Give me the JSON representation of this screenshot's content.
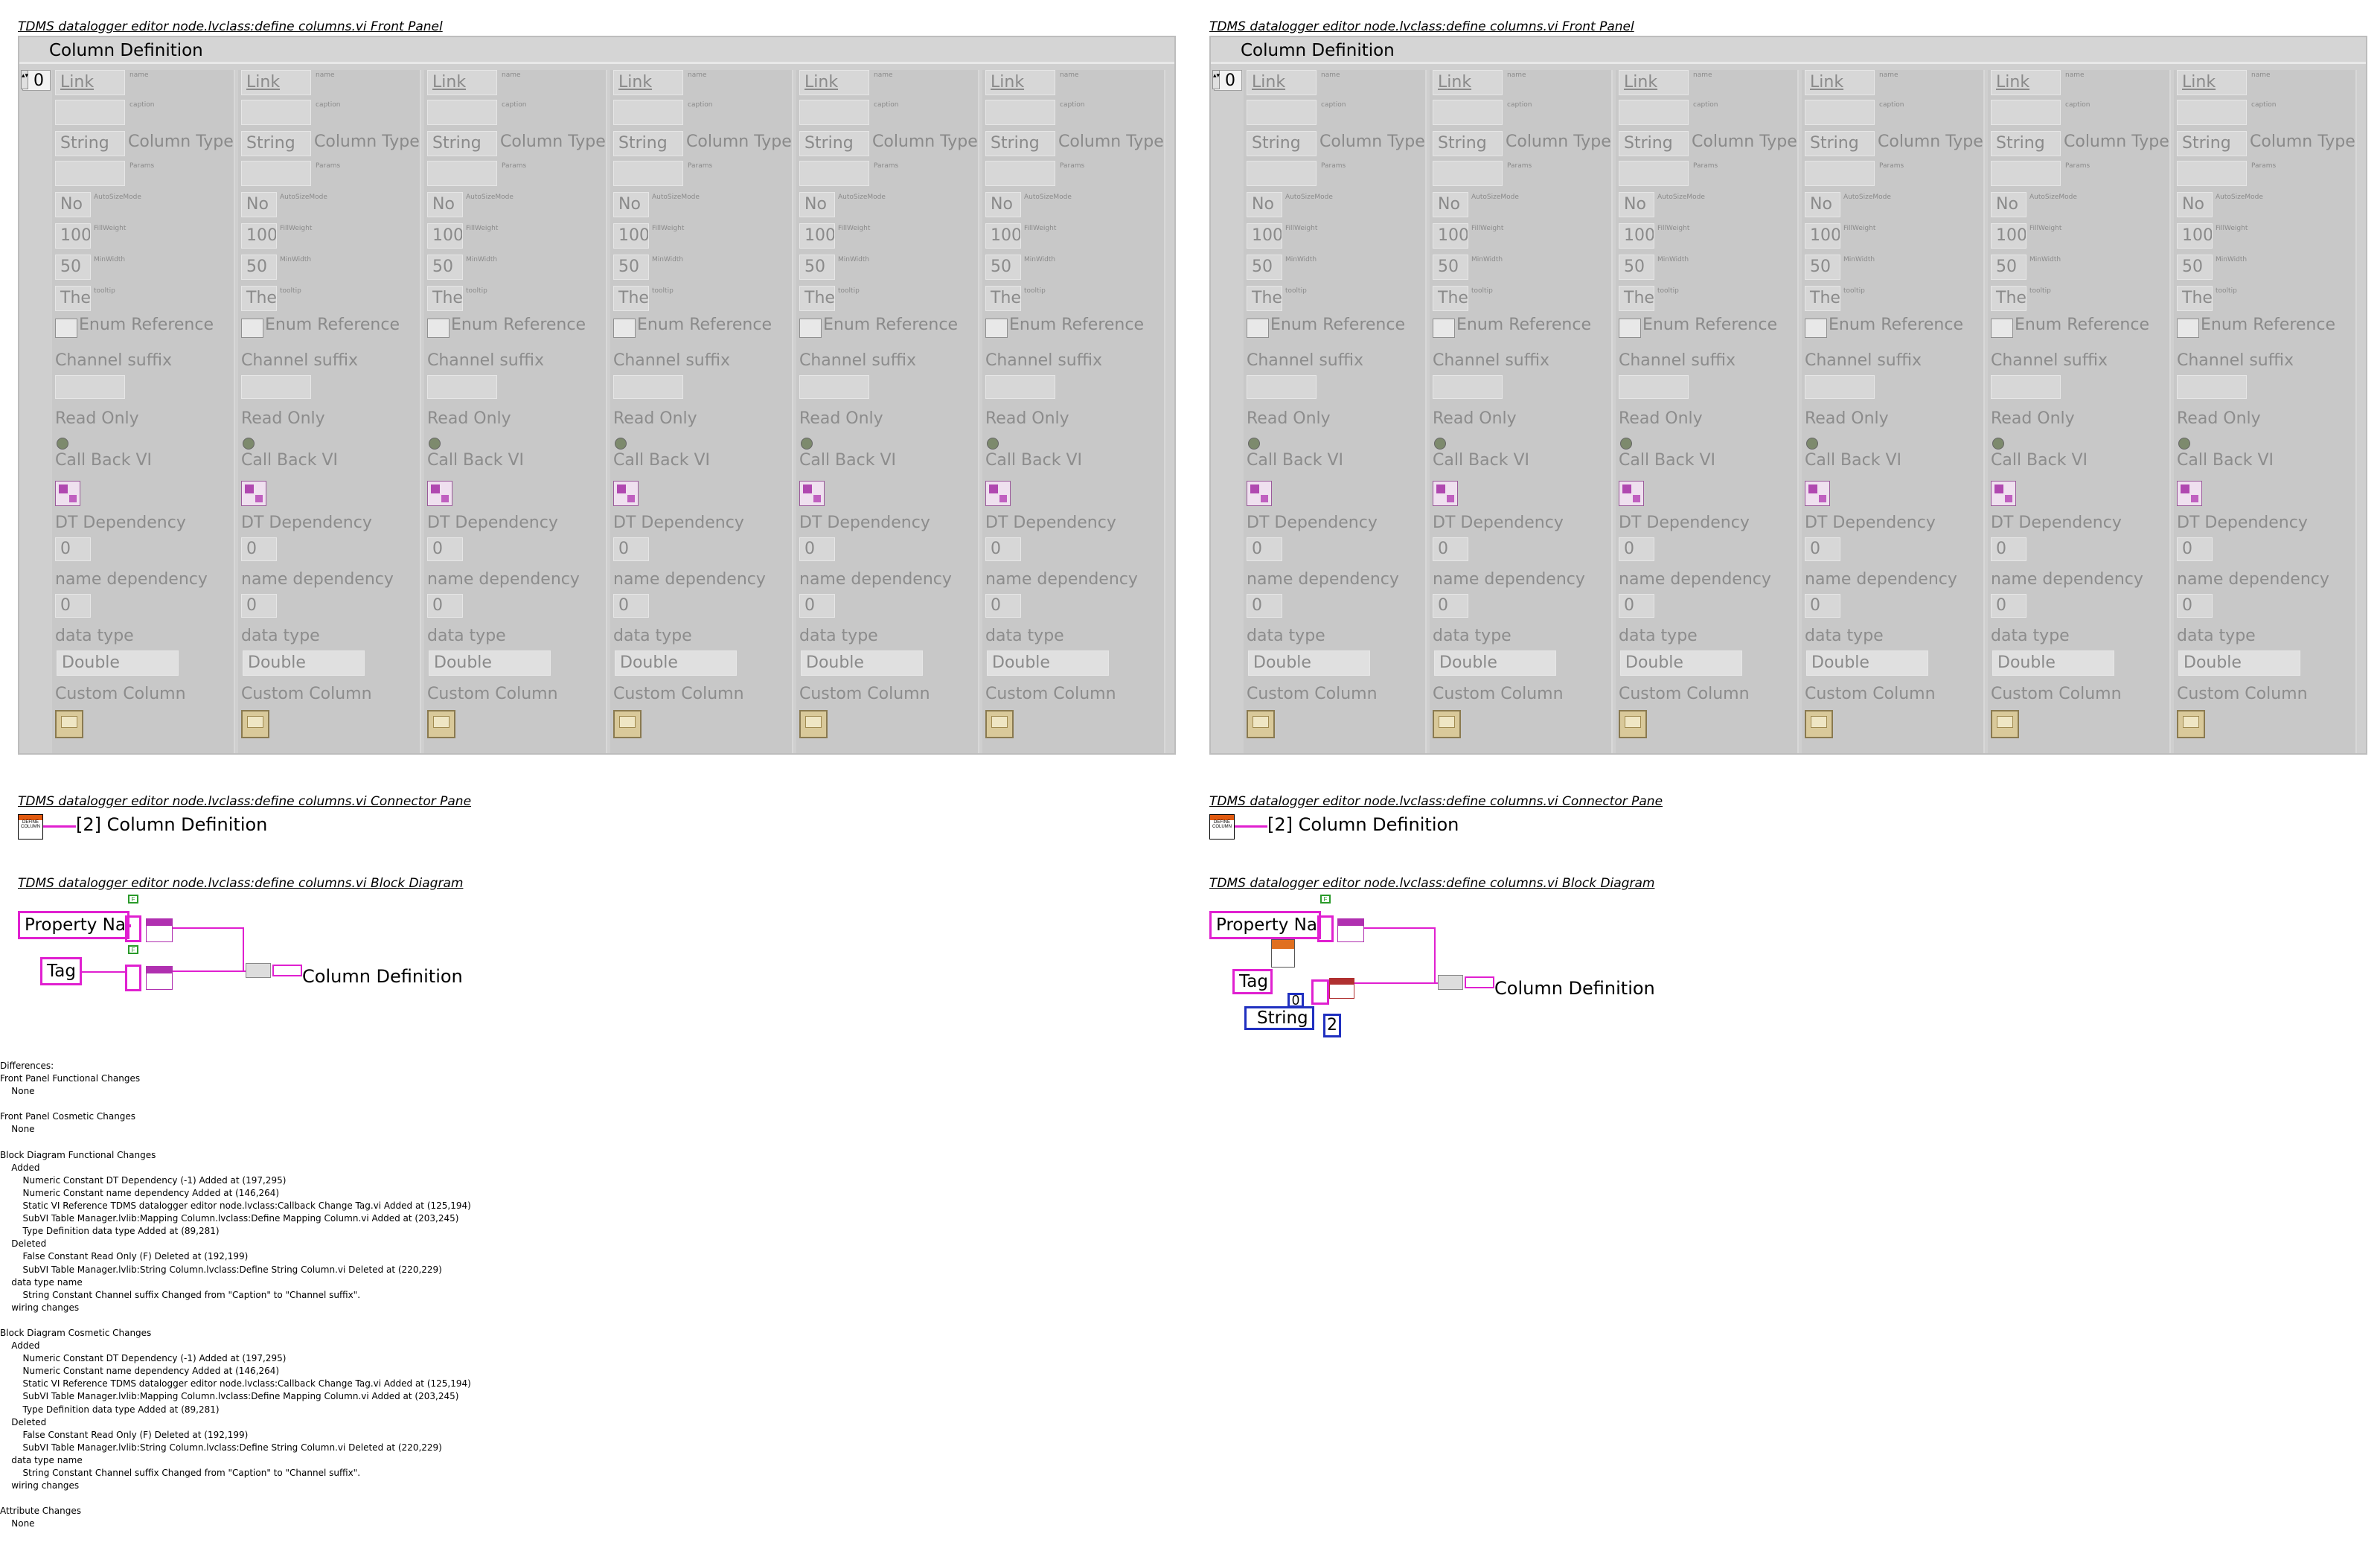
{
  "left": {
    "front_panel_title": "TDMS datalogger editor node.lvclass:define columns.vi Front Panel",
    "connector_title": "TDMS datalogger editor node.lvclass:define columns.vi Connector Pane",
    "block_title": "TDMS datalogger editor node.lvclass:define columns.vi Block Diagram"
  },
  "right": {
    "front_panel_title": "TDMS datalogger editor node.lvclass:define columns.vi Front Panel",
    "connector_title": "TDMS datalogger editor node.lvclass:define columns.vi Connector Pane",
    "block_title": "TDMS datalogger editor node.lvclass:define columns.vi Block Diagram"
  },
  "panel": {
    "header": "Column Definition",
    "index": "0",
    "column": {
      "name_value": "Link",
      "name_label": "name",
      "caption_label": "caption",
      "type_value": "String",
      "type_label": "Column Type",
      "params_label": "Params",
      "autosize_value": "No",
      "autosize_label": "AutoSizeMode",
      "fillweight_value": "100",
      "fillweight_label": "FillWeight",
      "minwidth_value": "50",
      "minwidth_label": "MinWidth",
      "tooltip_value": "The",
      "tooltip_label": "tooltip",
      "enum_label": "Enum Reference",
      "suffix_label": "Channel suffix",
      "readonly_label": "Read Only",
      "callback_label": "Call Back VI",
      "dt_label": "DT Dependency",
      "dt_value": "0",
      "namedep_label": "name dependency",
      "namedep_value": "0",
      "datatype_label": "data type",
      "datatype_value": "Double",
      "custom_label": "Custom Column"
    }
  },
  "connector": {
    "label": "[2] Column Definition",
    "icon_text": "DEFINE COLUMN"
  },
  "block_left": {
    "prop": "Property Nam",
    "tag": "Tag",
    "out": "Column Definition"
  },
  "block_right": {
    "prop": "Property Nam",
    "tag": "Tag",
    "string": "String",
    "zero": "0",
    "two": "2",
    "out": "Column Definition"
  },
  "differences": "Differences:\nFront Panel Functional Changes\n    None\n\nFront Panel Cosmetic Changes\n    None\n\nBlock Diagram Functional Changes\n    Added\n        Numeric Constant DT Dependency (-1) Added at (197,295)\n        Numeric Constant name dependency Added at (146,264)\n        Static VI Reference TDMS datalogger editor node.lvclass:Callback Change Tag.vi Added at (125,194)\n        SubVI Table Manager.lvlib:Mapping Column.lvclass:Define Mapping Column.vi Added at (203,245)\n        Type Definition data type Added at (89,281)\n    Deleted\n        False Constant Read Only (F) Deleted at (192,199)\n        SubVI Table Manager.lvlib:String Column.lvclass:Define String Column.vi Deleted at (220,229)\n    data type name\n        String Constant Channel suffix Changed from \"Caption\" to \"Channel suffix\".\n    wiring changes\n\nBlock Diagram Cosmetic Changes\n    Added\n        Numeric Constant DT Dependency (-1) Added at (197,295)\n        Numeric Constant name dependency Added at (146,264)\n        Static VI Reference TDMS datalogger editor node.lvclass:Callback Change Tag.vi Added at (125,194)\n        SubVI Table Manager.lvlib:Mapping Column.lvclass:Define Mapping Column.vi Added at (203,245)\n        Type Definition data type Added at (89,281)\n    Deleted\n        False Constant Read Only (F) Deleted at (192,199)\n        SubVI Table Manager.lvlib:String Column.lvclass:Define String Column.vi Deleted at (220,229)\n    data type name\n        String Constant Channel suffix Changed from \"Caption\" to \"Channel suffix\".\n    wiring changes\n\nAttribute Changes\n    None"
}
